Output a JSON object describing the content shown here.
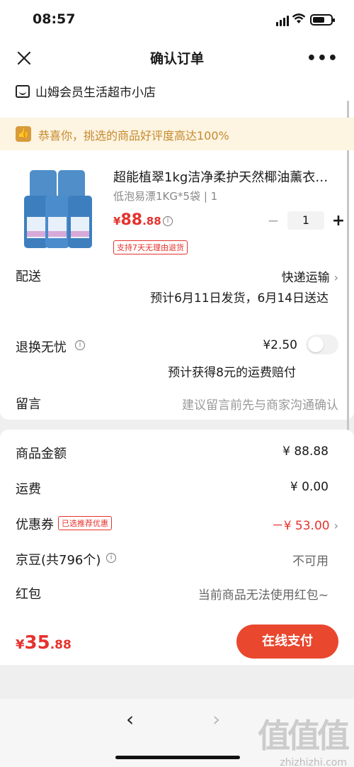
{
  "status": {
    "time": "08:57"
  },
  "nav": {
    "title": "确认订单",
    "more": "•••"
  },
  "store": {
    "name": "山姆会员生活超市小店"
  },
  "banner": {
    "text": "恭喜你，挑选的商品好评度高达100%"
  },
  "product": {
    "title": "超能植翠1kg洁净柔护天然椰油薰衣…",
    "spec": "低泡易漂1KG*5袋 | 1",
    "price": {
      "currency": "¥",
      "integer": "88",
      "decimal": ".88"
    },
    "quantity": "1",
    "return_tag": "支持7天无理由退货",
    "image_label": "超能"
  },
  "delivery": {
    "label": "配送",
    "method": "快递运输",
    "estimate": "预计6月11日发货，6月14日送达"
  },
  "return_worry": {
    "label": "退换无忧",
    "price": "¥2.50",
    "note": "预计获得8元的运费赔付"
  },
  "message": {
    "label": "留言",
    "placeholder": "建议留言前先与商家沟通确认"
  },
  "summary": {
    "goods_label": "商品金额",
    "goods_value": "¥ 88.88",
    "shipping_label": "运费",
    "shipping_value": "¥ 0.00",
    "coupon_label": "优惠券",
    "coupon_tag": "已选推荐优惠",
    "coupon_value": "－¥ 53.00",
    "beans_label": "京豆(共796个)",
    "beans_value": "不可用",
    "redpacket_label": "红包",
    "redpacket_value": "当前商品无法使用红包~"
  },
  "pay": {
    "currency": "¥",
    "integer": "35",
    "decimal": ".88",
    "button": "在线支付"
  },
  "watermark": {
    "text": "zhizhizhi.com",
    "logo": "值值值"
  },
  "colors": {
    "accent": "#e5322d",
    "pay_button": "#e9472e",
    "banner_bg": "#fdf4e2",
    "banner_text": "#c58a2c"
  }
}
